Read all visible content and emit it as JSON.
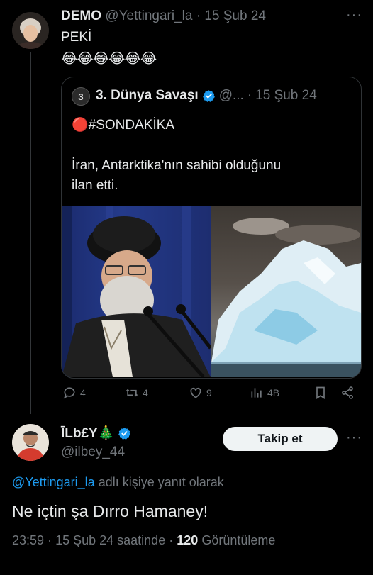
{
  "parent_tweet": {
    "name": "DEMO",
    "handle": "@Yettingari_la",
    "separator": "·",
    "date": "15 Şub 24",
    "more": "···",
    "text_line1": "PEKİ",
    "text_line2": "😂😂😂😂😂😂"
  },
  "quote_tweet": {
    "avatar_glyph": "3",
    "name": "3. Dünya Savaşı",
    "verified_icon": "verified-badge-icon",
    "handle": "@...",
    "separator": "·",
    "date": "15 Şub 24",
    "breaking": "🔴#SONDAKİKA",
    "text_line1": "İran, Antarktika'nın sahibi olduğunu",
    "text_line2": "ilan etti."
  },
  "actions": {
    "replies": "4",
    "retweets": "4",
    "likes": "9",
    "views": "4B"
  },
  "reply_tweet": {
    "name": "ĪLb£Y🎄",
    "handle": "@ilbey_44",
    "follow_label": "Takip et",
    "more": "···",
    "reply_to_handle": "@Yettingari_la",
    "reply_to_suffix": "adlı kişiye yanıt olarak",
    "text": "Ne içtin şa Dırro Hamaney!",
    "time": "23:59",
    "separator1": "·",
    "date": "15 Şub 24 saatinde",
    "separator2": "·",
    "views_count": "120",
    "views_label": "Görüntüleme"
  },
  "colors": {
    "background": "#000000",
    "text": "#e7e9ea",
    "muted": "#71767b",
    "link": "#1d9bf0",
    "verified": "#1d9bf0",
    "button_bg": "#eff3f4"
  }
}
